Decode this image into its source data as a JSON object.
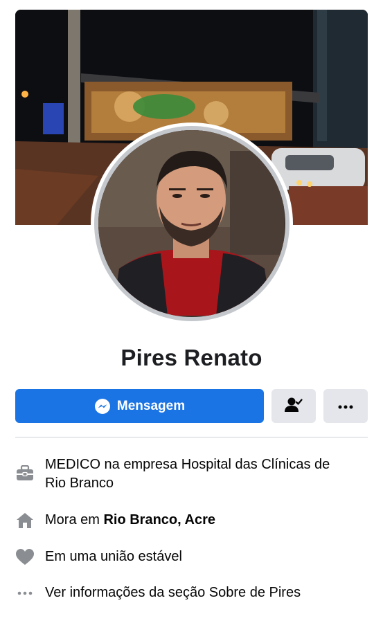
{
  "profile": {
    "name": "Pires Renato"
  },
  "actions": {
    "message_label": "Mensagem"
  },
  "intro": {
    "work": {
      "prefix": "MEDICO na empresa Hospital das Clínicas de Rio Branco"
    },
    "lives": {
      "prefix": "Mora em ",
      "place": "Rio Branco, Acre"
    },
    "relationship": {
      "text": "Em uma união estável"
    },
    "see_about": {
      "text": "Ver informações da seção Sobre de Pires"
    }
  },
  "icons": {
    "messenger": "messenger-icon",
    "friend": "friend-check-icon",
    "more": "more-dots-icon",
    "work": "briefcase-icon",
    "home": "home-icon",
    "relationship": "heart-icon",
    "about": "dots-icon"
  },
  "colors": {
    "primary": "#1b74e4",
    "secondary_button": "#e4e6eb",
    "icon_gray": "#8a8d91",
    "text": "#050505"
  }
}
